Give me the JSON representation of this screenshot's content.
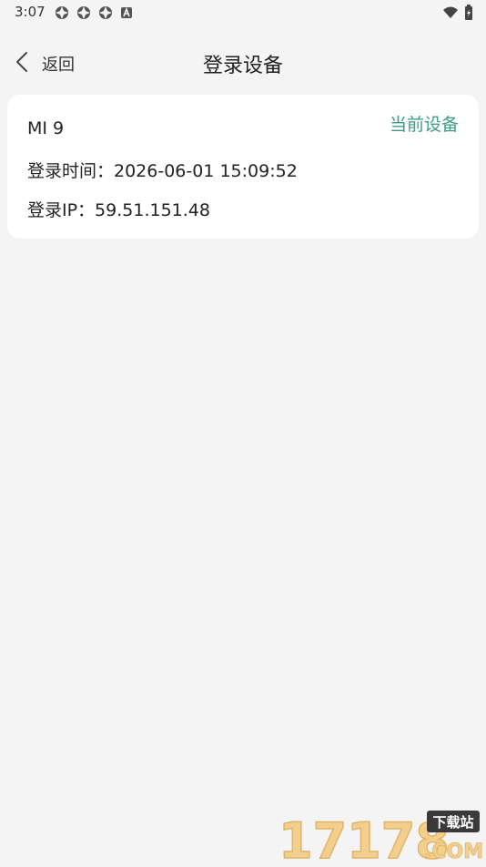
{
  "status_bar": {
    "time": "3:07",
    "left_icons": [
      "app-notification-icon",
      "app-notification-icon",
      "app-notification-icon",
      "a-badge-icon"
    ],
    "right_icons": [
      "wifi-icon",
      "battery-icon"
    ]
  },
  "header": {
    "back_label": "返回",
    "title": "登录设备"
  },
  "device": {
    "name": "MI 9",
    "current_label": "当前设备",
    "login_time": "登录时间：2026-06-01 15:09:52",
    "login_ip": "登录IP：59.51.151.48"
  },
  "watermark": {
    "number_text": "17178",
    "com_text": ".COM",
    "tag_text": "下载站"
  },
  "colors": {
    "background": "#f4f4f4",
    "card": "#ffffff",
    "accent": "#3d9c86"
  }
}
